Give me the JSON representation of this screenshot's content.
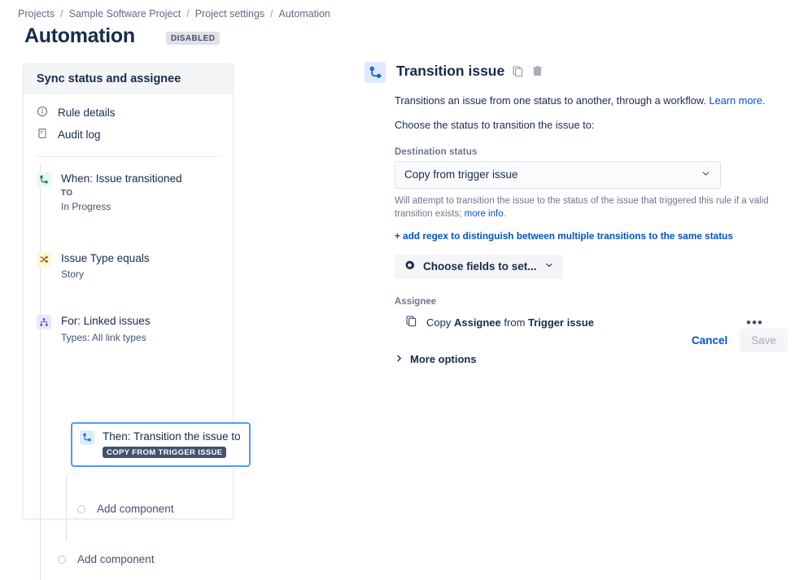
{
  "breadcrumb": {
    "items": [
      {
        "label": "Projects",
        "link": true
      },
      {
        "label": "Sample Software Project",
        "link": true
      },
      {
        "label": "Project settings",
        "link": true
      },
      {
        "label": "Automation",
        "link": false
      }
    ],
    "separator": "/"
  },
  "header": {
    "title": "Automation",
    "status_badge": "DISABLED"
  },
  "sidebar": {
    "panel_title": "Sync status and assignee",
    "nav": [
      {
        "label": "Rule details",
        "icon": "info-circle-icon"
      },
      {
        "label": "Audit log",
        "icon": "document-icon"
      }
    ],
    "tree": [
      {
        "title": "When: Issue transitioned",
        "caption": "TO",
        "sub": "In Progress",
        "icon": "transition-icon",
        "icon_color": "#E3FCEF"
      },
      {
        "title": "Issue Type equals",
        "caption": "",
        "sub": "Story",
        "icon": "shuffle-icon",
        "icon_color": "#FFF7D6"
      },
      {
        "title": "For: Linked issues",
        "caption": "",
        "sub": "Types: All link types",
        "icon": "branch-icon",
        "icon_color": "#EAE6FF"
      }
    ],
    "then_card": {
      "title": "Then: Transition the issue to",
      "badge": "COPY FROM TRIGGER ISSUE",
      "icon": "transition-icon",
      "selected_border_color": "#4C9AFF"
    },
    "add_component_inner": "Add component",
    "add_component_outer": "Add component"
  },
  "detail": {
    "icon": "transition-icon",
    "title": "Transition issue",
    "copy_icon": "copy-icon",
    "delete_icon": "trash-icon",
    "description": "Transitions an issue from one status to another, through a workflow.",
    "description_link": "Learn more.",
    "question": "Choose the status to transition the issue to:",
    "destination_status": {
      "label": "Destination status",
      "value": "Copy from trigger issue",
      "chevron": "chevron-down-icon"
    },
    "help_text": "Will attempt to transition the issue to the status of the issue that triggered this rule if a valid transition exists;",
    "help_link": "more info",
    "help_text_end": ".",
    "regex_link": "+ add regex to distinguish between multiple transitions to the same status",
    "choose_fields": {
      "label": "Choose fields to set...",
      "gear_icon": "gear-icon",
      "chevron": "chevron-down-icon"
    },
    "assignee": {
      "label": "Assignee",
      "copy_icon": "copy-icon",
      "text_prefix": "Copy ",
      "text_field": "Assignee",
      "text_middle": " from ",
      "text_source": "Trigger issue",
      "more_menu": "•••"
    },
    "more_options": {
      "label": "More options",
      "chevron": "chevron-right-icon"
    }
  },
  "actions": {
    "cancel": "Cancel",
    "save": "Save"
  },
  "colors": {
    "link": "#0052CC",
    "selected_border": "#4C9AFF",
    "badge_bg": "#DFE1E6",
    "lozenge_bg": "#42526E"
  }
}
